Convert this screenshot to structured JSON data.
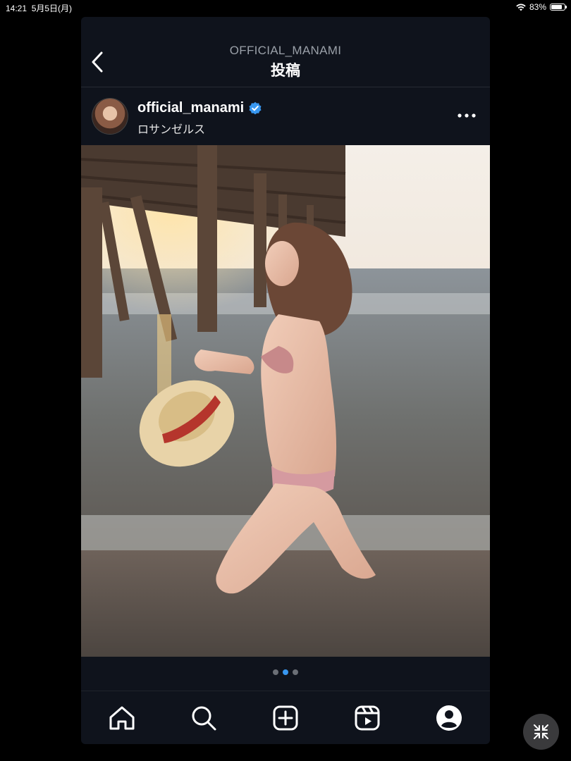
{
  "status_bar": {
    "time": "14:21",
    "date": "5月5日(月)",
    "battery_text": "83%",
    "battery_level": 0.83,
    "wifi_icon": "wifi-icon"
  },
  "nav": {
    "account": "OFFICIAL_MANAMI",
    "title": "投稿",
    "back_icon": "chevron-left-icon"
  },
  "post": {
    "username": "official_manami",
    "verified": true,
    "location": "ロサンゼルス",
    "more_icon": "more-horizontal-icon",
    "image_description_icon": "photo",
    "carousel": {
      "count": 3,
      "active_index": 1
    }
  },
  "tabbar": {
    "items": [
      {
        "name": "home",
        "icon": "home-icon"
      },
      {
        "name": "search",
        "icon": "search-icon"
      },
      {
        "name": "create",
        "icon": "plus-square-icon"
      },
      {
        "name": "reels",
        "icon": "reels-icon"
      },
      {
        "name": "profile",
        "icon": "profile-icon"
      }
    ]
  },
  "colors": {
    "background": "#000000",
    "app_bg": "#0f131c",
    "accent": "#3897f0",
    "muted": "#9aa0a8"
  }
}
